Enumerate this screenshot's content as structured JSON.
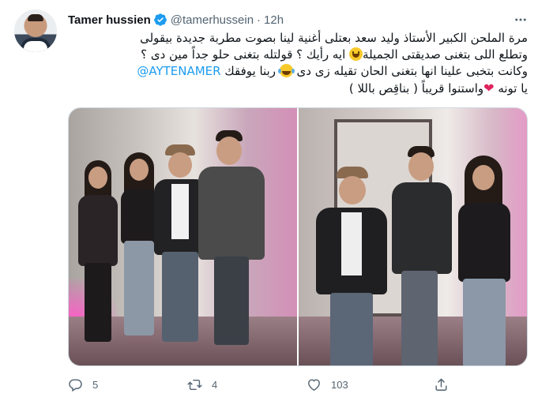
{
  "tweet": {
    "display_name": "Tamer hussien",
    "handle": "@tamerhussein",
    "separator": "·",
    "time": "12h",
    "text_lines": [
      "مرة الملحن الكبير الأستاذ وليد سعد بعتلى أغنية لينا بصوت مطربة جديدة بيقولى",
      "ايه رأيك ؟ قولتله بتغنى حلو جداً مين دى ؟",
      "وتطلع اللى بتغنى صديقتى الجميلة",
      "@AYTENAMER",
      "وكانت بتخبى  علينا انها بتغنى الحان تقيله زى دى",
      "ربنا يوفقك",
      "يا تونه",
      "واستنوا قريباً ( بناقِص باللا )"
    ]
  },
  "actions": {
    "reply_count": "5",
    "retweet_count": "4",
    "like_count": "103"
  },
  "icons": {
    "verified": "verified-badge-icon",
    "more": "more-options-icon",
    "reply": "reply-icon",
    "retweet": "retweet-icon",
    "like": "like-icon",
    "share": "share-icon"
  },
  "colors": {
    "accent": "#1d9bf0",
    "text": "#0f1419",
    "muted": "#536471",
    "heart": "#e0245e"
  }
}
